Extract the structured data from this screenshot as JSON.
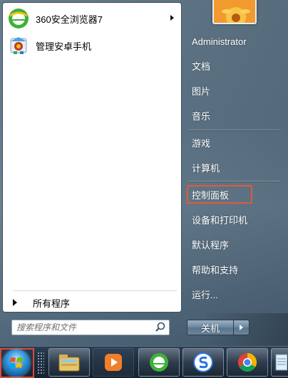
{
  "start_menu": {
    "pinned_programs": [
      {
        "label": "360安全浏览器7",
        "icon": "360-browser-icon",
        "has_submenu": true
      },
      {
        "label": "管理安卓手机",
        "icon": "android-manager-icon",
        "has_submenu": false
      }
    ],
    "all_programs_label": "所有程序",
    "search": {
      "placeholder": "搜索程序和文件"
    },
    "user_name": "Administrator",
    "right_links": [
      {
        "label": "文档"
      },
      {
        "label": "图片"
      },
      {
        "label": "音乐"
      },
      {
        "label": "游戏"
      },
      {
        "label": "计算机"
      },
      {
        "label": "控制面板",
        "highlighted": true
      },
      {
        "label": "设备和打印机"
      },
      {
        "label": "默认程序"
      },
      {
        "label": "帮助和支持"
      },
      {
        "label": "运行..."
      }
    ],
    "shutdown_label": "关机"
  },
  "taskbar": {
    "buttons": [
      {
        "icon": "file-explorer-icon"
      },
      {
        "icon": "media-player-icon"
      },
      {
        "icon": "360-browser-icon"
      },
      {
        "icon": "sogou-input-icon"
      },
      {
        "icon": "chrome-icon"
      },
      {
        "icon": "notepad-icon"
      }
    ]
  },
  "colors": {
    "highlight_border": "#e05a3a",
    "orb_border": "#d94b3a"
  }
}
